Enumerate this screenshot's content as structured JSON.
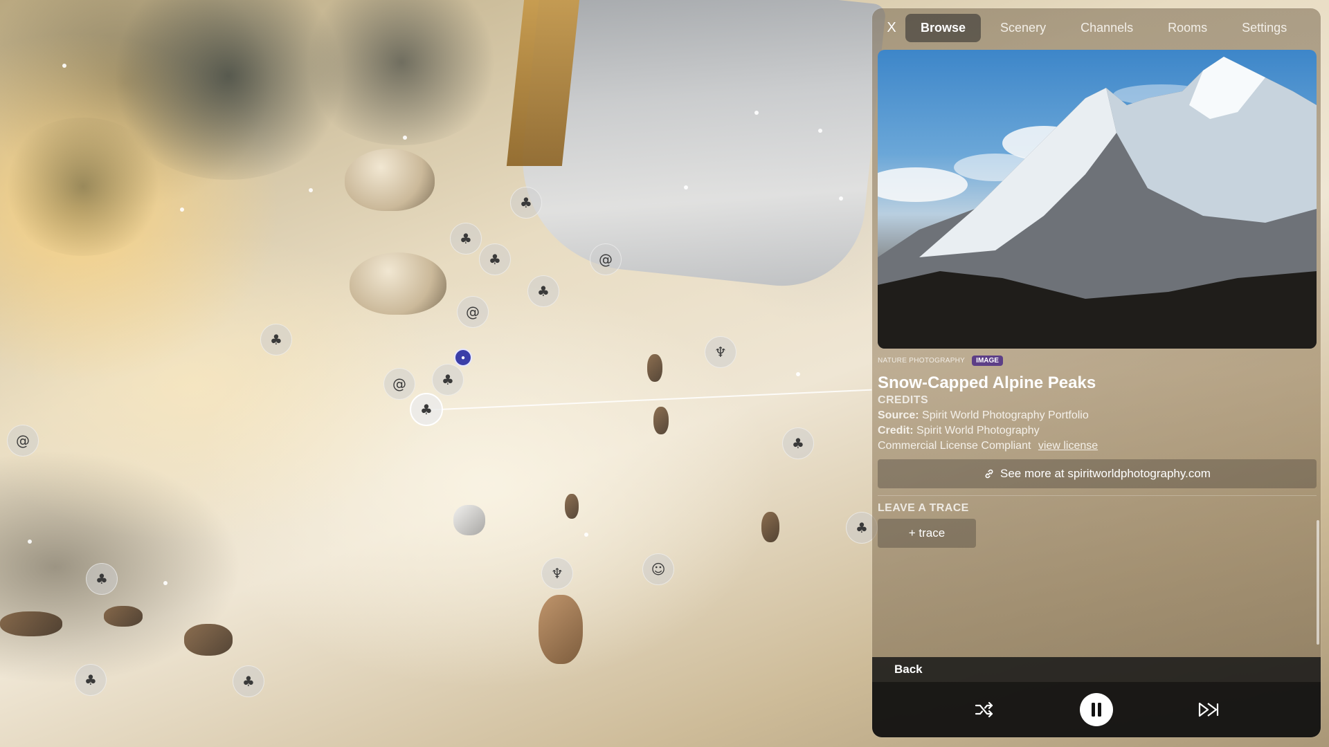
{
  "panel": {
    "close_label": "X",
    "tabs": [
      {
        "label": "Browse",
        "active": true
      },
      {
        "label": "Scenery",
        "active": false
      },
      {
        "label": "Channels",
        "active": false
      },
      {
        "label": "Rooms",
        "active": false
      },
      {
        "label": "Settings",
        "active": false
      }
    ],
    "item": {
      "category": "NATURE PHOTOGRAPHY",
      "type_badge": "IMAGE",
      "title": "Snow-Capped Alpine Peaks"
    },
    "credits": {
      "heading": "CREDITS",
      "source_label": "Source:",
      "source_value": "Spirit World Photography Portfolio",
      "credit_label": "Credit:",
      "credit_value": "Spirit World Photography",
      "license_text": "Commercial License Compliant",
      "license_link": "view license"
    },
    "see_more": "See more at spiritworldphotography.com",
    "trace": {
      "heading": "LEAVE A TRACE",
      "button": "+ trace"
    },
    "back": "Back"
  },
  "colors": {
    "type_badge": "#5d3f87",
    "avatar": "#3b3ea8"
  },
  "icons": {
    "close": "close-icon",
    "link": "link-icon",
    "shuffle": "shuffle-icon",
    "pause": "pause-icon",
    "skip": "skip-forward-icon",
    "markers": [
      "trees-icon",
      "spiral-icon",
      "jellyfish-icon",
      "cat-icon"
    ]
  }
}
